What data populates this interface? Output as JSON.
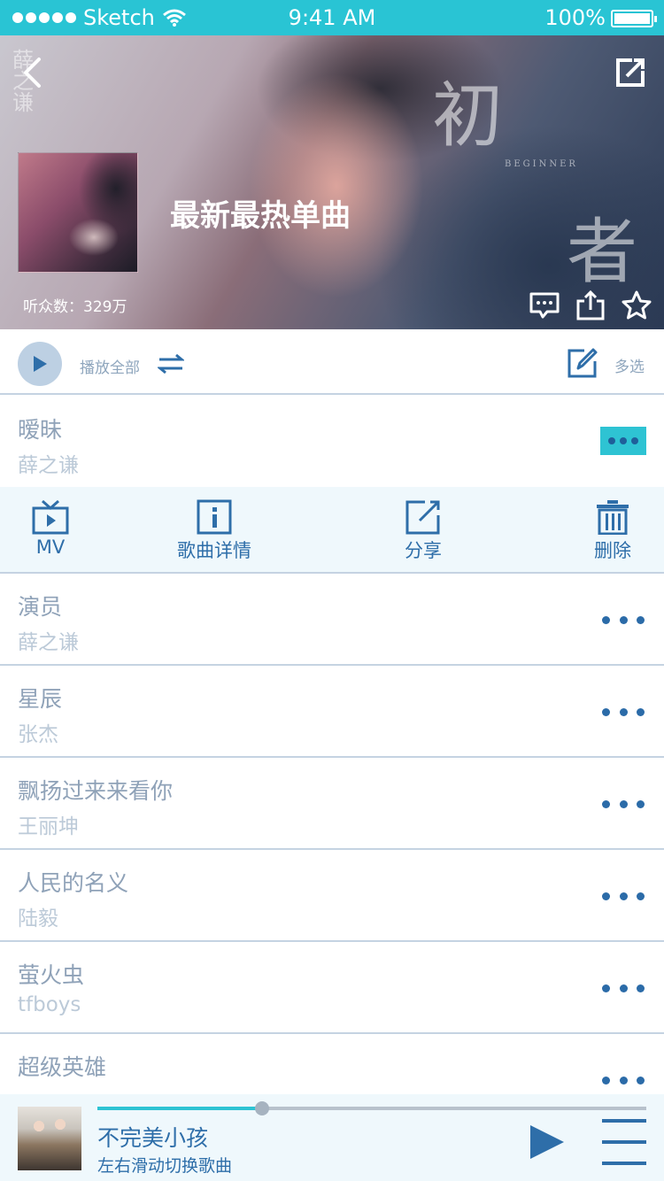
{
  "status_bar": {
    "carrier": "Sketch",
    "time": "9:41 AM",
    "battery": "100%"
  },
  "header": {
    "title": "最新最热单曲",
    "listeners": "听众数：329万",
    "deco_1": "初",
    "deco_2": "者",
    "deco_3": "BEGINNER",
    "deco_4": "薛之谦"
  },
  "toolbar": {
    "play_all_label": "播放全部",
    "multi_select_label": "多选"
  },
  "songs": [
    {
      "title": "暧昧",
      "artist": "薛之谦"
    },
    {
      "title": "演员",
      "artist": "薛之谦"
    },
    {
      "title": "星辰",
      "artist": "张杰"
    },
    {
      "title": "飘扬过来来看你",
      "artist": "王丽坤"
    },
    {
      "title": "人民的名义",
      "artist": "陆毅"
    },
    {
      "title": "萤火虫",
      "artist": "tfboys"
    },
    {
      "title": "超级英雄",
      "artist": ""
    }
  ],
  "actions": [
    {
      "label": "MV",
      "icon": "tv-icon"
    },
    {
      "label": "歌曲详情",
      "icon": "info-icon"
    },
    {
      "label": "分享",
      "icon": "share-icon"
    },
    {
      "label": "删除",
      "icon": "trash-icon"
    }
  ],
  "player": {
    "title": "不完美小孩",
    "subtitle": "左右滑动切换歌曲",
    "progress": 0.3
  },
  "colors": {
    "accent": "#29c4d4",
    "primary": "#2e6ea9",
    "muted_text": "#8fa2b8"
  }
}
